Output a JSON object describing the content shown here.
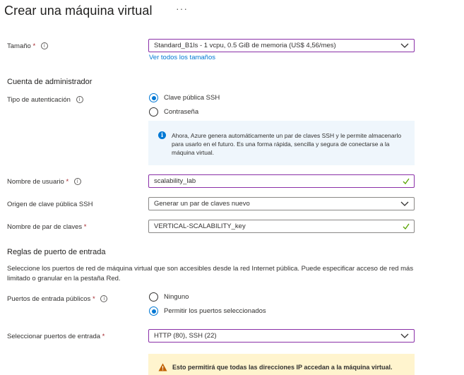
{
  "header": {
    "title": "Crear una máquina virtual",
    "more_label": "···"
  },
  "size": {
    "label": "Tamaño",
    "required": "*",
    "info_icon": "info-icon",
    "value": "Standard_B1ls - 1 vcpu, 0.5 GiB de memoria (US$ 4,56/mes)",
    "link": "Ver todos los tamaños"
  },
  "admin": {
    "section_title": "Cuenta de administrador",
    "auth_type": {
      "label": "Tipo de autenticación",
      "options": [
        {
          "label": "Clave pública SSH",
          "selected": true
        },
        {
          "label": "Contraseña",
          "selected": false
        }
      ]
    },
    "info_box": {
      "icon": "info-icon",
      "text": "Ahora, Azure genera automáticamente un par de claves SSH y le permite almacenarlo para usarlo en el futuro. Es una forma rápida, sencilla y segura de conectarse a la máquina virtual."
    },
    "username": {
      "label": "Nombre de usuario",
      "required": "*",
      "value": "scalability_lab"
    },
    "ssh_source": {
      "label": "Origen de clave pública SSH",
      "value": "Generar un par de claves nuevo"
    },
    "key_pair_name": {
      "label": "Nombre de par de claves",
      "required": "*",
      "value": "VERTICAL-SCALABILITY_key"
    }
  },
  "inbound": {
    "section_title": "Reglas de puerto de entrada",
    "description": "Seleccione los puertos de red de máquina virtual que son accesibles desde la red Internet pública. Puede especificar acceso de red más limitado o granular en la pestaña Red.",
    "public_ports": {
      "label": "Puertos de entrada públicos",
      "required": "*",
      "options": [
        {
          "label": "Ninguno",
          "selected": false
        },
        {
          "label": "Permitir los puertos seleccionados",
          "selected": true
        }
      ]
    },
    "select_ports": {
      "label": "Seleccionar puertos de entrada",
      "required": "*",
      "value": "HTTP (80), SSH (22)"
    },
    "warning": {
      "icon": "warning-icon",
      "text": "Esto permitirá que todas las direcciones IP accedan a la máquina virtual."
    }
  },
  "colors": {
    "accent": "#0078d4",
    "purple_border": "#8a2fa7",
    "valid_check": "#57a300",
    "info_bg": "#eff6fc",
    "warning_bg": "#fff4ce"
  }
}
